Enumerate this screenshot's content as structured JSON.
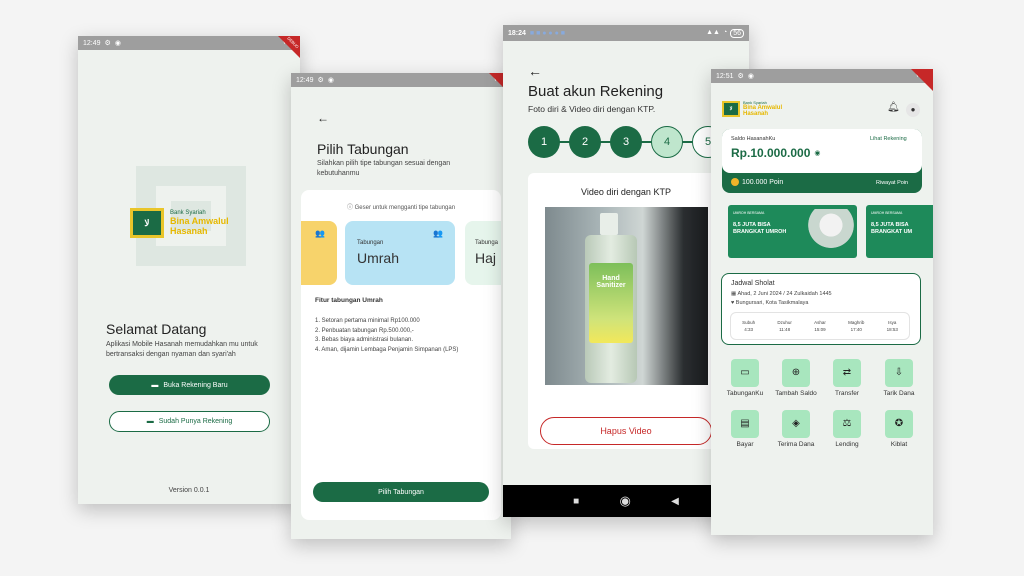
{
  "phone1": {
    "time": "12:49",
    "debug": "DEBUG",
    "logo_bank": "Bank Syariah",
    "logo_name1": "Bina Amwalul",
    "logo_name2": "Hasanah",
    "welcome_title": "Selamat Datang",
    "welcome_text": "Aplikasi Mobile Hasanah memudahkan mu untuk bertransaksi dengan nyaman dan syari'ah",
    "btn_new": "Buka Rekening Baru",
    "btn_existing": "Sudah Punya Rekening",
    "version": "Version 0.0.1"
  },
  "phone2": {
    "time": "12:49",
    "title": "Pilih Tabungan",
    "subtitle": "Silahkan pilih tipe tabungan sesuai dengan kebutuhanmu",
    "hint": "Geser untuk mengganti tipe tabungan",
    "card_label": "Tabungan",
    "card_name": "Umrah",
    "card_next_label": "Tabunga",
    "card_next_name": "Haj",
    "features_title": "Fitur tabungan Umrah",
    "features": [
      "1. Setoran pertama minimal Rp100.000",
      "2. Penbuatan tabungan Rp.500.000,-",
      "3. Bebas biaya administrasi bulanan.",
      "4. Aman, dijamin Lembaga Penjamin Simpanan (LPS)"
    ],
    "btn": "Pilih Tabungan"
  },
  "phone3": {
    "time": "18:24",
    "battery": "56",
    "title": "Buat akun Rekening",
    "subtitle": "Foto diri & Video diri dengan KTP.",
    "steps": [
      "1",
      "2",
      "3",
      "4",
      "5"
    ],
    "video_title": "Video diri dengan KTP",
    "bottle_text1": "Hand",
    "bottle_text2": "Sanitizer",
    "btn_delete": "Hapus Video"
  },
  "phone4": {
    "time": "12:51",
    "logo_bank": "Bank Syariah",
    "logo_name1": "Bina Amwalul",
    "logo_name2": "Hasanah",
    "balance_label": "Saldo HasanahKu",
    "balance_link": "Lihat Rekening",
    "balance": "Rp.10.000.000",
    "points": "100.000 Poin",
    "points_link": "Riwayat Poin",
    "banner_small": "UMROH BERSAMA",
    "banner_big1": "8,5 JUTA BISA",
    "banner_big2": "BRANGKAT UMROH",
    "banner_big2_cut": "BRANGKAT UM",
    "prayer_title": "Jadwal Sholat",
    "prayer_date": "Ahad, 2 Juni 2024 / 24 Zulkaidah 1445",
    "prayer_location": "Bungursari, Kota Tasikmalaya",
    "prayers": [
      {
        "name": "Subuh",
        "time": "4:33"
      },
      {
        "name": "Dzuhur",
        "time": "11:48"
      },
      {
        "name": "Ashar",
        "time": "15:09"
      },
      {
        "name": "Maghrib",
        "time": "17:40"
      },
      {
        "name": "Isya",
        "time": "18:53"
      }
    ],
    "menu": [
      "TabunganKu",
      "Tambah Saldo",
      "Transfer",
      "Tarik Dana",
      "Bayar",
      "Terima Dana",
      "Lending",
      "Kiblat"
    ]
  }
}
